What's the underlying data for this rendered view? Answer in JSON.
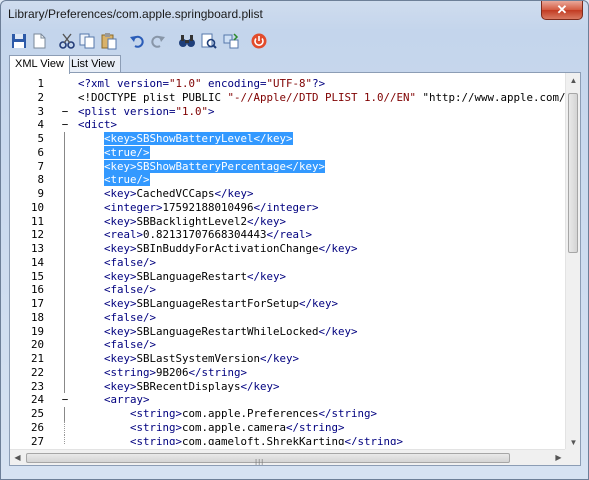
{
  "window": {
    "title": "Library/Preferences/com.apple.springboard.plist",
    "close_label": "✕"
  },
  "toolbar": {
    "buttons": [
      {
        "name": "save-icon"
      },
      {
        "name": "new-document-icon"
      },
      {
        "name": "cut-icon"
      },
      {
        "name": "copy-icon"
      },
      {
        "name": "paste-icon"
      },
      {
        "name": "undo-icon"
      },
      {
        "name": "redo-icon"
      },
      {
        "name": "find-icon"
      },
      {
        "name": "find-next-icon"
      },
      {
        "name": "replace-icon"
      },
      {
        "name": "power-icon"
      }
    ]
  },
  "tabs": [
    {
      "label": "XML View",
      "active": true
    },
    {
      "label": "List View",
      "active": false
    }
  ],
  "editor": {
    "lines": [
      {
        "n": "1",
        "fold": "",
        "hl": false,
        "t": "<?xml version=\"1.0\" encoding=\"UTF-8\"?>"
      },
      {
        "n": "2",
        "fold": "",
        "hl": false,
        "t": "<!DOCTYPE plist PUBLIC \"-//Apple//DTD PLIST 1.0//EN\" \"http://www.apple.com/"
      },
      {
        "n": "3",
        "fold": "−",
        "hl": false,
        "t": "<plist version=\"1.0\">"
      },
      {
        "n": "4",
        "fold": "−",
        "hl": false,
        "t": "<dict>"
      },
      {
        "n": "5",
        "fold": "",
        "hl": true,
        "t": "    <key>SBShowBatteryLevel</key>"
      },
      {
        "n": "6",
        "fold": "",
        "hl": true,
        "t": "    <true/>"
      },
      {
        "n": "7",
        "fold": "",
        "hl": true,
        "t": "    <key>SBShowBatteryPercentage</key>"
      },
      {
        "n": "8",
        "fold": "",
        "hl": true,
        "t": "    <true/>"
      },
      {
        "n": "9",
        "fold": "",
        "hl": false,
        "t": "    <key>CachedVCCaps</key>"
      },
      {
        "n": "10",
        "fold": "",
        "hl": false,
        "t": "    <integer>17592188010496</integer>"
      },
      {
        "n": "11",
        "fold": "",
        "hl": false,
        "t": "    <key>SBBacklightLevel2</key>"
      },
      {
        "n": "12",
        "fold": "",
        "hl": false,
        "t": "    <real>0.82131707668304443</real>"
      },
      {
        "n": "13",
        "fold": "",
        "hl": false,
        "t": "    <key>SBInBuddyForActivationChange</key>"
      },
      {
        "n": "14",
        "fold": "",
        "hl": false,
        "t": "    <false/>"
      },
      {
        "n": "15",
        "fold": "",
        "hl": false,
        "t": "    <key>SBLanguageRestart</key>"
      },
      {
        "n": "16",
        "fold": "",
        "hl": false,
        "t": "    <false/>"
      },
      {
        "n": "17",
        "fold": "",
        "hl": false,
        "t": "    <key>SBLanguageRestartForSetup</key>"
      },
      {
        "n": "18",
        "fold": "",
        "hl": false,
        "t": "    <false/>"
      },
      {
        "n": "19",
        "fold": "",
        "hl": false,
        "t": "    <key>SBLanguageRestartWhileLocked</key>"
      },
      {
        "n": "20",
        "fold": "",
        "hl": false,
        "t": "    <false/>"
      },
      {
        "n": "21",
        "fold": "",
        "hl": false,
        "t": "    <key>SBLastSystemVersion</key>"
      },
      {
        "n": "22",
        "fold": "",
        "hl": false,
        "t": "    <string>9B206</string>"
      },
      {
        "n": "23",
        "fold": "",
        "hl": false,
        "t": "    <key>SBRecentDisplays</key>"
      },
      {
        "n": "24",
        "fold": "−",
        "hl": false,
        "t": "    <array>"
      },
      {
        "n": "25",
        "fold": "",
        "hl": false,
        "t": "        <string>com.apple.Preferences</string>"
      },
      {
        "n": "26",
        "fold": "",
        "hl": false,
        "t": "        <string>com.apple.camera</string>"
      },
      {
        "n": "27",
        "fold": "",
        "hl": false,
        "t": "        <string>com.gameloft.ShrekKarting</string>"
      }
    ]
  },
  "colors": {
    "selection": "#3399ff",
    "tag": "#00007f",
    "string": "#7f0000",
    "close": "#c23b22"
  }
}
